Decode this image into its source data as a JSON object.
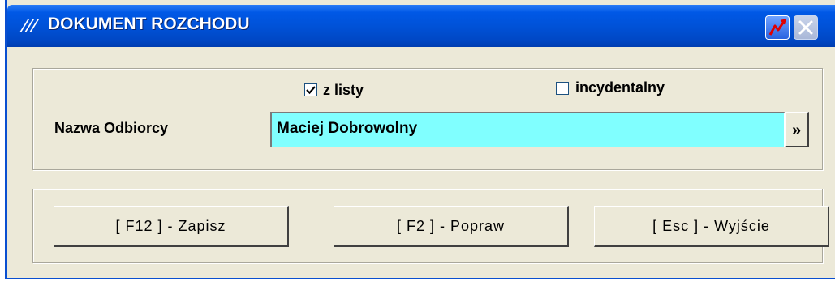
{
  "window": {
    "title": "DOKUMENT ROZCHODU"
  },
  "titlebar": {
    "logo_icon": "app-logo-icon",
    "help_icon": "help-icon",
    "close_icon": "close-icon"
  },
  "form": {
    "checkbox_from_list": {
      "label": "z listy",
      "checked": true
    },
    "checkbox_incidental": {
      "label": "incydentalny",
      "checked": false
    },
    "recipient_label": "Nazwa Odbiorcy",
    "recipient_value": "Maciej Dobrowolny",
    "more_button_label": "»"
  },
  "actions": {
    "save_label": "[ F12 ] - Zapisz",
    "fix_label": "[ F2 ] - Popraw",
    "exit_label": "[ Esc ] - Wyjście"
  },
  "colors": {
    "titlebar": "#0052d8",
    "window_bg": "#ece9d8",
    "input_bg": "#80ffff"
  }
}
